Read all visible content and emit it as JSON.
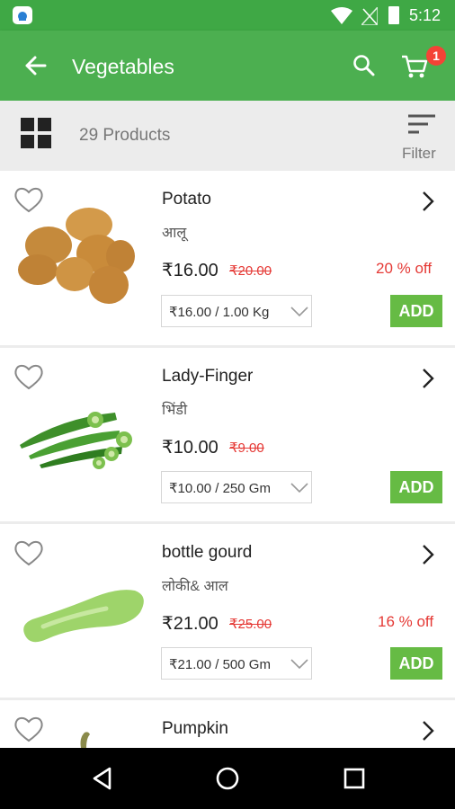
{
  "status_bar": {
    "time": "5:12"
  },
  "app_bar": {
    "title": "Vegetables",
    "cart_count": "1"
  },
  "toolbar": {
    "products_count": "29 Products",
    "filter_label": "Filter"
  },
  "products": [
    {
      "name": "Potato",
      "local_name": "आलू",
      "price": "₹16.00",
      "mrp": "₹20.00",
      "discount": "20 % off",
      "variant": "₹16.00 / 1.00 Kg",
      "add_label": "ADD"
    },
    {
      "name": "Lady-Finger",
      "local_name": "भिंडी",
      "price": "₹10.00",
      "mrp": "₹9.00",
      "discount": "",
      "variant": "₹10.00 / 250 Gm",
      "add_label": "ADD"
    },
    {
      "name": "bottle gourd",
      "local_name": "लोकी& आल",
      "price": "₹21.00",
      "mrp": "₹25.00",
      "discount": "16 % off",
      "variant": "₹21.00 / 500 Gm",
      "add_label": "ADD"
    },
    {
      "name": "Pumpkin"
    }
  ],
  "colors": {
    "primary": "#4caf50",
    "status_bar": "#3fa845",
    "discount": "#e53935",
    "add_button": "#66bb44",
    "badge": "#f44336"
  }
}
